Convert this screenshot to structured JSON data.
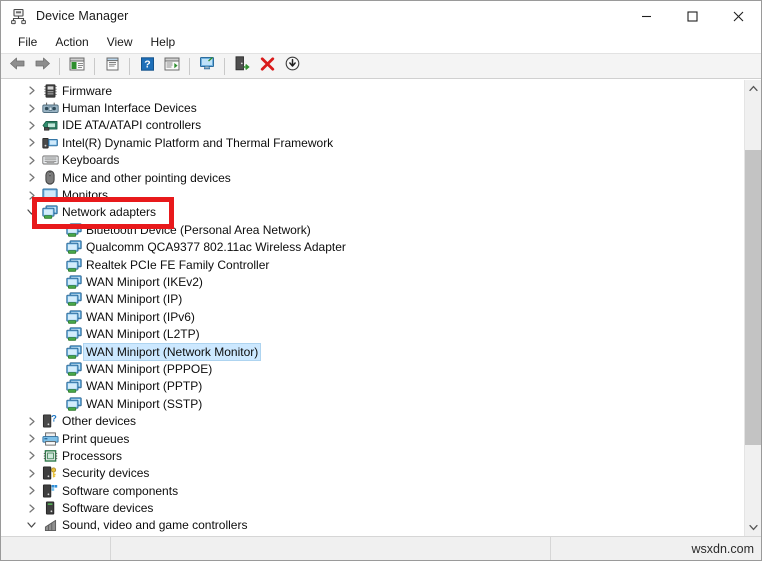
{
  "window": {
    "title": "Device Manager",
    "icon": "device-manager-icon",
    "controls": {
      "minimize": "—",
      "maximize": "☐",
      "close": "✕"
    }
  },
  "menubar": {
    "items": [
      {
        "label": "File",
        "name": "menu-file"
      },
      {
        "label": "Action",
        "name": "menu-action"
      },
      {
        "label": "View",
        "name": "menu-view"
      },
      {
        "label": "Help",
        "name": "menu-help"
      }
    ]
  },
  "toolbar": {
    "buttons": [
      {
        "name": "back-button",
        "icon": "back-arrow-icon",
        "tooltip": "Back"
      },
      {
        "name": "forward-button",
        "icon": "forward-arrow-icon",
        "tooltip": "Forward"
      },
      {
        "name": "show-hide-console-tree-button",
        "icon": "console-tree-icon",
        "tooltip": "Show/Hide Console Tree"
      },
      {
        "name": "properties-button",
        "icon": "properties-icon",
        "tooltip": "Properties"
      },
      {
        "name": "help-button",
        "icon": "help-question-icon",
        "tooltip": "Help"
      },
      {
        "name": "show-hide-action-pane-button",
        "icon": "action-pane-icon",
        "tooltip": "Show/Hide Action Pane"
      },
      {
        "name": "scan-hardware-changes-button",
        "icon": "scan-monitor-icon",
        "tooltip": "Scan for hardware changes"
      },
      {
        "name": "update-driver-button",
        "icon": "update-driver-icon",
        "tooltip": "Update driver"
      },
      {
        "name": "uninstall-device-button",
        "icon": "red-x-icon",
        "tooltip": "Uninstall device"
      },
      {
        "name": "disable-device-button",
        "icon": "down-arrow-circle-icon",
        "tooltip": "Disable device"
      }
    ]
  },
  "tree": {
    "rows": [
      {
        "label": "Firmware",
        "level": 1,
        "icon": "firmware-icon",
        "expander": "collapsed",
        "selected": false,
        "clipped": false
      },
      {
        "label": "Human Interface Devices",
        "level": 1,
        "icon": "hid-icon",
        "expander": "collapsed",
        "selected": false,
        "clipped": false
      },
      {
        "label": "IDE ATA/ATAPI controllers",
        "level": 1,
        "icon": "ide-controller-icon",
        "expander": "collapsed",
        "selected": false,
        "clipped": false
      },
      {
        "label": "Intel(R) Dynamic Platform and Thermal Framework",
        "level": 1,
        "icon": "thermal-framework-icon",
        "expander": "collapsed",
        "selected": false,
        "clipped": false
      },
      {
        "label": "Keyboards",
        "level": 1,
        "icon": "keyboard-icon",
        "expander": "collapsed",
        "selected": false,
        "clipped": false
      },
      {
        "label": "Mice and other pointing devices",
        "level": 1,
        "icon": "mouse-icon",
        "expander": "collapsed",
        "selected": false,
        "clipped": false
      },
      {
        "label": "Monitors",
        "level": 1,
        "icon": "monitor-icon",
        "expander": "collapsed",
        "selected": false,
        "clipped": true
      },
      {
        "label": "Network adapters",
        "level": 1,
        "icon": "network-adapter-icon",
        "expander": "expanded",
        "selected": false,
        "clipped": false
      },
      {
        "label": "Bluetooth Device (Personal Area Network)",
        "level": 2,
        "icon": "network-adapter-icon",
        "expander": "none",
        "selected": false,
        "clipped": true
      },
      {
        "label": "Qualcomm QCA9377 802.11ac Wireless Adapter",
        "level": 2,
        "icon": "network-adapter-icon",
        "expander": "none",
        "selected": false,
        "clipped": false
      },
      {
        "label": "Realtek PCIe FE Family Controller",
        "level": 2,
        "icon": "network-adapter-icon",
        "expander": "none",
        "selected": false,
        "clipped": false
      },
      {
        "label": "WAN Miniport (IKEv2)",
        "level": 2,
        "icon": "network-adapter-icon",
        "expander": "none",
        "selected": false,
        "clipped": false
      },
      {
        "label": "WAN Miniport (IP)",
        "level": 2,
        "icon": "network-adapter-icon",
        "expander": "none",
        "selected": false,
        "clipped": false
      },
      {
        "label": "WAN Miniport (IPv6)",
        "level": 2,
        "icon": "network-adapter-icon",
        "expander": "none",
        "selected": false,
        "clipped": false
      },
      {
        "label": "WAN Miniport (L2TP)",
        "level": 2,
        "icon": "network-adapter-icon",
        "expander": "none",
        "selected": false,
        "clipped": false
      },
      {
        "label": "WAN Miniport (Network Monitor)",
        "level": 2,
        "icon": "network-adapter-icon",
        "expander": "none",
        "selected": true,
        "clipped": false
      },
      {
        "label": "WAN Miniport (PPPOE)",
        "level": 2,
        "icon": "network-adapter-icon",
        "expander": "none",
        "selected": false,
        "clipped": false
      },
      {
        "label": "WAN Miniport (PPTP)",
        "level": 2,
        "icon": "network-adapter-icon",
        "expander": "none",
        "selected": false,
        "clipped": false
      },
      {
        "label": "WAN Miniport (SSTP)",
        "level": 2,
        "icon": "network-adapter-icon",
        "expander": "none",
        "selected": false,
        "clipped": false
      },
      {
        "label": "Other devices",
        "level": 1,
        "icon": "other-devices-icon",
        "expander": "collapsed",
        "selected": false,
        "clipped": false
      },
      {
        "label": "Print queues",
        "level": 1,
        "icon": "printer-icon",
        "expander": "collapsed",
        "selected": false,
        "clipped": false
      },
      {
        "label": "Processors",
        "level": 1,
        "icon": "processor-icon",
        "expander": "collapsed",
        "selected": false,
        "clipped": false
      },
      {
        "label": "Security devices",
        "level": 1,
        "icon": "security-device-icon",
        "expander": "collapsed",
        "selected": false,
        "clipped": false
      },
      {
        "label": "Software components",
        "level": 1,
        "icon": "software-component-icon",
        "expander": "collapsed",
        "selected": false,
        "clipped": false
      },
      {
        "label": "Software devices",
        "level": 1,
        "icon": "software-device-icon",
        "expander": "collapsed",
        "selected": false,
        "clipped": false
      },
      {
        "label": "Sound, video and game controllers",
        "level": 1,
        "icon": "sound-controller-icon",
        "expander": "expanded",
        "selected": false,
        "clipped": true
      }
    ]
  },
  "annotation": {
    "redbox": {
      "label": "network-adapters-highlight",
      "color": "#e8191b"
    }
  },
  "scrollbar": {
    "up_arrow": "⌃",
    "down_arrow": "⌄"
  },
  "statusbar": {
    "watermark": "wsxdn.com"
  }
}
